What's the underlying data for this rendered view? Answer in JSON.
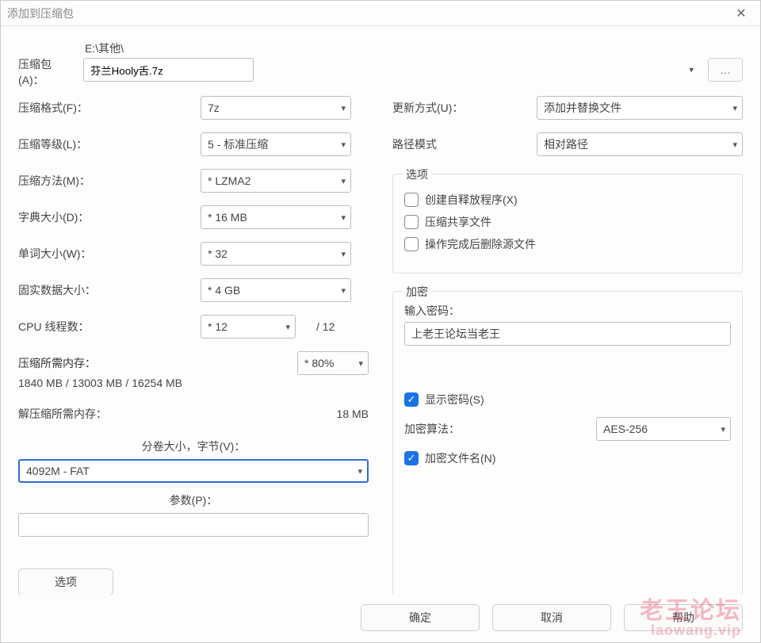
{
  "title": "添加到压缩包",
  "archive": {
    "label": "压缩包(A)：",
    "path": "E:\\其他\\",
    "filename": "芬兰Hooly舌.7z",
    "browse": "…"
  },
  "left": {
    "format": {
      "label": "压缩格式(F)：",
      "value": "7z"
    },
    "level": {
      "label": "压缩等级(L)：",
      "value": "5 - 标准压缩"
    },
    "method": {
      "label": "压缩方法(M)：",
      "value": "* LZMA2"
    },
    "dict": {
      "label": "字典大小(D)：",
      "value": "* 16 MB"
    },
    "word": {
      "label": "单词大小(W)：",
      "value": "* 32"
    },
    "solid": {
      "label": "固实数据大小：",
      "value": "* 4 GB"
    },
    "threads": {
      "label": "CPU 线程数：",
      "value": "* 12",
      "total": "/ 12"
    },
    "compress_mem": {
      "label": "压缩所需内存：",
      "detail": "1840 MB / 13003 MB / 16254 MB",
      "pct": "* 80%"
    },
    "decompress_mem": {
      "label": "解压缩所需内存：",
      "value": "18 MB"
    },
    "split": {
      "label": "分卷大小，字节(V)：",
      "value": "4092M - FAT"
    },
    "params": {
      "label": "参数(P)："
    },
    "options_btn": "选项"
  },
  "right": {
    "update": {
      "label": "更新方式(U)：",
      "value": "添加并替换文件"
    },
    "pathmode": {
      "label": "路径模式",
      "value": "相对路径"
    },
    "options_group": "选项",
    "opt_sfx": "创建自释放程序(X)",
    "opt_shared": "压缩共享文件",
    "opt_delete": "操作完成后删除源文件",
    "enc_group": "加密",
    "pwd_label": "输入密码：",
    "pwd_value": "上老王论坛当老王",
    "show_pwd": "显示密码(S)",
    "enc_method_label": "加密算法：",
    "enc_method_value": "AES-256",
    "enc_names": "加密文件名(N)"
  },
  "footer": {
    "ok": "确定",
    "cancel": "取消",
    "help": "帮助"
  },
  "watermark": {
    "l1": "老王论坛",
    "l2": "laowang.vip"
  }
}
